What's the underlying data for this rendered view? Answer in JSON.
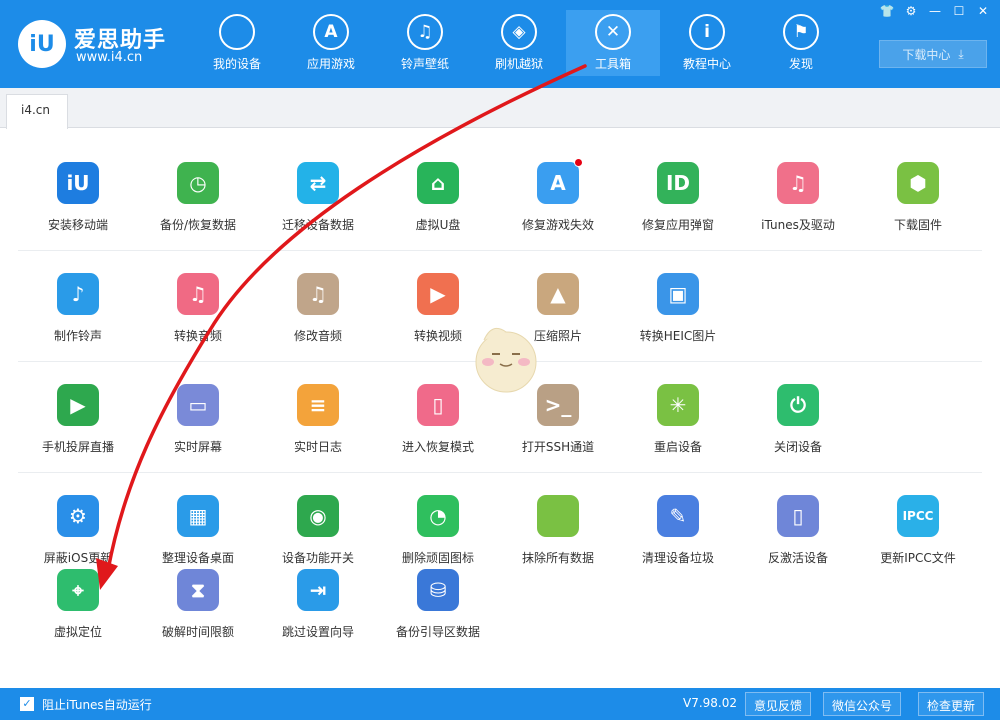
{
  "app": {
    "brand_name": "爱思助手",
    "brand_url": "www.i4.cn",
    "logo_text": "iU"
  },
  "nav": [
    {
      "label": "我的设备",
      "icon": "apple-icon",
      "glyph": "",
      "active": false
    },
    {
      "label": "应用游戏",
      "icon": "appstore-icon",
      "glyph": "A",
      "active": false
    },
    {
      "label": "铃声壁纸",
      "icon": "music-folder-icon",
      "glyph": "♫",
      "active": false
    },
    {
      "label": "刷机越狱",
      "icon": "dropbox-icon",
      "glyph": "◈",
      "active": false
    },
    {
      "label": "工具箱",
      "icon": "tools-icon",
      "glyph": "✕",
      "active": true
    },
    {
      "label": "教程中心",
      "icon": "info-icon",
      "glyph": "i",
      "active": false
    },
    {
      "label": "发现",
      "icon": "flag-icon",
      "glyph": "⚑",
      "active": false
    }
  ],
  "window_controls": [
    "👕",
    "⚙",
    "—",
    "☐",
    "✕"
  ],
  "download_center": "下载中心",
  "tab": "i4.cn",
  "tools": [
    [
      {
        "label": "安装移动端",
        "icon": "i4-app-icon",
        "color": "#1e7de0",
        "glyph": "iU"
      },
      {
        "label": "备份/恢复数据",
        "icon": "backup-clock-icon",
        "color": "#3fb34f",
        "glyph": "◷"
      },
      {
        "label": "迁移设备数据",
        "icon": "transfer-phones-icon",
        "color": "#23b2e8",
        "glyph": "⇄"
      },
      {
        "label": "虚拟U盘",
        "icon": "usb-drive-icon",
        "color": "#28b45a",
        "glyph": "⌂"
      },
      {
        "label": "修复游戏失效",
        "icon": "appstore-repair-icon",
        "color": "#3a9ef0",
        "glyph": "A",
        "dot": true
      },
      {
        "label": "修复应用弹窗",
        "icon": "apple-id-icon",
        "color": "#33b25a",
        "glyph": "ID"
      },
      {
        "label": "iTunes及驱动",
        "icon": "itunes-icon",
        "color": "#f0708a",
        "glyph": "♫"
      },
      {
        "label": "下载固件",
        "icon": "firmware-box-icon",
        "color": "#7ac143",
        "glyph": "⬢"
      }
    ],
    [
      {
        "label": "制作铃声",
        "icon": "bell-icon",
        "color": "#2a9be8",
        "glyph": "♪"
      },
      {
        "label": "转换音频",
        "icon": "music-convert-icon",
        "color": "#f06a84",
        "glyph": "♫"
      },
      {
        "label": "修改音频",
        "icon": "music-edit-icon",
        "color": "#c0a58a",
        "glyph": "♫"
      },
      {
        "label": "转换视频",
        "icon": "video-convert-icon",
        "color": "#f07050",
        "glyph": "▶"
      },
      {
        "label": "压缩照片",
        "icon": "photo-icon",
        "color": "#c9a77e",
        "glyph": "▲"
      },
      {
        "label": "转换HEIC图片",
        "icon": "heic-icon",
        "color": "#3a95e8",
        "glyph": "▣"
      }
    ],
    [
      {
        "label": "手机投屏直播",
        "icon": "screen-cast-icon",
        "color": "#2ea84e",
        "glyph": "▶"
      },
      {
        "label": "实时屏幕",
        "icon": "monitor-icon",
        "color": "#7a8ad8",
        "glyph": "▭"
      },
      {
        "label": "实时日志",
        "icon": "log-file-icon",
        "color": "#f3a33b",
        "glyph": "≡"
      },
      {
        "label": "进入恢复模式",
        "icon": "recovery-mode-icon",
        "color": "#f06a8a",
        "glyph": "▯"
      },
      {
        "label": "打开SSH通道",
        "icon": "ssh-terminal-icon",
        "color": "#b9a085",
        "glyph": ">_"
      },
      {
        "label": "重启设备",
        "icon": "restart-icon",
        "color": "#7ac143",
        "glyph": "✳"
      },
      {
        "label": "关闭设备",
        "icon": "power-icon",
        "color": "#2ebd6e",
        "glyph": "⏻"
      }
    ],
    [
      {
        "label": "屏蔽iOS更新",
        "icon": "block-update-gear-icon",
        "color": "#2a8fe8",
        "glyph": "⚙"
      },
      {
        "label": "整理设备桌面",
        "icon": "desktop-grid-icon",
        "color": "#2a9be8",
        "glyph": "▦"
      },
      {
        "label": "设备功能开关",
        "icon": "toggle-icon",
        "color": "#2ea84e",
        "glyph": "◉"
      },
      {
        "label": "删除顽固图标",
        "icon": "pie-icon",
        "color": "#2fbf5e",
        "glyph": "◔"
      },
      {
        "label": "抹除所有数据",
        "icon": "erase-apple-icon",
        "color": "#7ac143",
        "glyph": ""
      },
      {
        "label": "清理设备垃圾",
        "icon": "broom-icon",
        "color": "#4a7fe0",
        "glyph": "✎"
      },
      {
        "label": "反激活设备",
        "icon": "deactivate-icon",
        "color": "#6f86d8",
        "glyph": "▯"
      },
      {
        "label": "更新IPCC文件",
        "icon": "ipcc-icon",
        "color": "#2ab0e8",
        "glyph": "IPCC"
      }
    ],
    [
      {
        "label": "虚拟定位",
        "icon": "location-pin-icon",
        "color": "#2ebd6e",
        "glyph": "⌖"
      },
      {
        "label": "破解时间限额",
        "icon": "hourglass-icon",
        "color": "#6f86d8",
        "glyph": "⧗"
      },
      {
        "label": "跳过设置向导",
        "icon": "skip-wizard-icon",
        "color": "#2a9be8",
        "glyph": "⇥"
      },
      {
        "label": "备份引导区数据",
        "icon": "disk-backup-icon",
        "color": "#3a78d8",
        "glyph": "⛁"
      }
    ]
  ],
  "status": {
    "block_itunes_label": "阻止iTunes自动运行",
    "version": "V7.98.02",
    "feedback": "意见反馈",
    "wechat": "微信公众号",
    "check_update": "检查更新"
  },
  "colors": {
    "header": "#1d8ce8",
    "arrow": "#e0181b"
  }
}
